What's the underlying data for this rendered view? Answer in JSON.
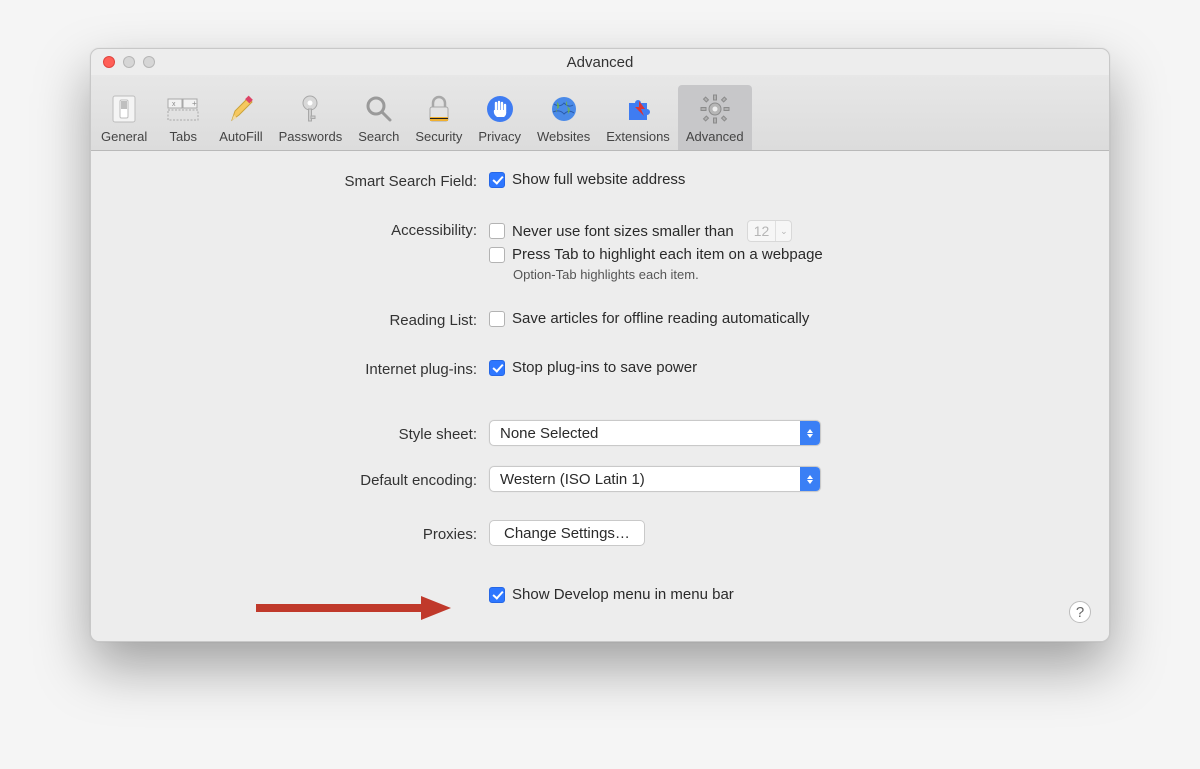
{
  "window": {
    "title": "Advanced"
  },
  "toolbar": [
    {
      "name": "general",
      "label": "General",
      "icon": "switch-icon"
    },
    {
      "name": "tabs",
      "label": "Tabs",
      "icon": "tabs-icon"
    },
    {
      "name": "autofill",
      "label": "AutoFill",
      "icon": "pencil-icon"
    },
    {
      "name": "passwords",
      "label": "Passwords",
      "icon": "key-icon"
    },
    {
      "name": "search",
      "label": "Search",
      "icon": "magnify-icon"
    },
    {
      "name": "security",
      "label": "Security",
      "icon": "lock-icon"
    },
    {
      "name": "privacy",
      "label": "Privacy",
      "icon": "hand-icon"
    },
    {
      "name": "websites",
      "label": "Websites",
      "icon": "globe-icon"
    },
    {
      "name": "extensions",
      "label": "Extensions",
      "icon": "puzzle-icon"
    },
    {
      "name": "advanced",
      "label": "Advanced",
      "icon": "gear-icon"
    }
  ],
  "selected_tab": "advanced",
  "smart_search": {
    "label": "Smart Search Field:",
    "show_full_url": {
      "text": "Show full website address",
      "checked": true
    }
  },
  "accessibility": {
    "label": "Accessibility:",
    "min_font": {
      "text": "Never use font sizes smaller than",
      "value": "12",
      "checked": false
    },
    "tab_highlight": {
      "text": "Press Tab to highlight each item on a webpage",
      "checked": false
    },
    "hint": "Option-Tab highlights each item."
  },
  "reading_list": {
    "label": "Reading List:",
    "offline": {
      "text": "Save articles for offline reading automatically",
      "checked": false
    }
  },
  "plugins": {
    "label": "Internet plug-ins:",
    "stop_power": {
      "text": "Stop plug-ins to save power",
      "checked": true
    }
  },
  "stylesheet": {
    "label": "Style sheet:",
    "value": "None Selected"
  },
  "encoding": {
    "label": "Default encoding:",
    "value": "Western (ISO Latin 1)"
  },
  "proxies": {
    "label": "Proxies:",
    "button": "Change Settings…"
  },
  "develop": {
    "text": "Show Develop menu in menu bar",
    "checked": true
  },
  "help_glyph": "?"
}
